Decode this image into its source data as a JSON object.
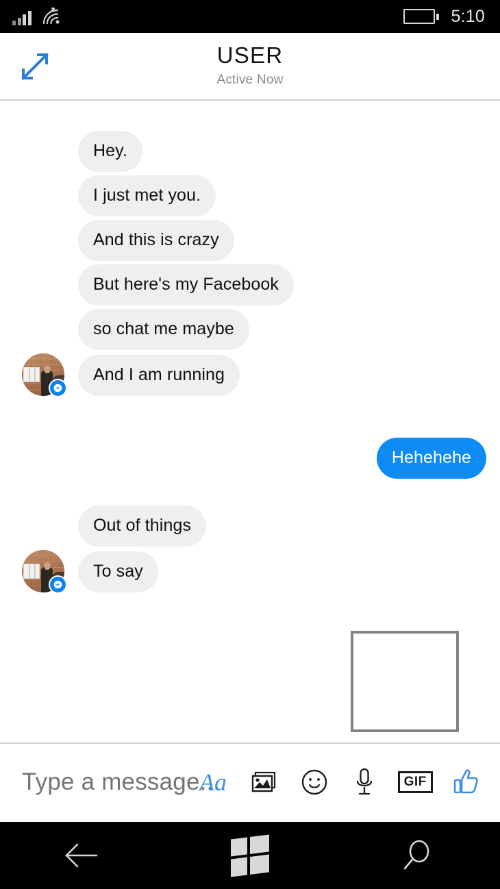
{
  "status_bar": {
    "signal_icon": "signal-bars-icon",
    "wifi_icon": "wifi-icon",
    "battery_icon": "battery-icon",
    "clock": "5:10"
  },
  "header": {
    "expand_icon": "expand-arrows-icon",
    "title": "USER",
    "subtitle": "Active Now"
  },
  "conversation": {
    "messages": [
      {
        "text": "Hey.",
        "side": "incoming"
      },
      {
        "text": "I just met you.",
        "side": "incoming"
      },
      {
        "text": "And this is crazy",
        "side": "incoming"
      },
      {
        "text": "But here's my Facebook",
        "side": "incoming"
      },
      {
        "text": "so chat me maybe",
        "side": "incoming"
      },
      {
        "text": "And I am running",
        "side": "incoming"
      },
      {
        "text": "Hehehehe",
        "side": "outgoing"
      },
      {
        "text": "Out of things",
        "side": "incoming"
      },
      {
        "text": "To say",
        "side": "incoming"
      }
    ],
    "avatar_badge_icon": "messenger-badge-icon",
    "image_placeholder": "image-attachment-placeholder"
  },
  "composer": {
    "placeholder": "Type a message...",
    "value": "",
    "actions": [
      {
        "name": "text-format-icon",
        "label": "Aa"
      },
      {
        "name": "photo-gallery-icon",
        "label": ""
      },
      {
        "name": "emoji-smiley-icon",
        "label": ""
      },
      {
        "name": "microphone-icon",
        "label": ""
      },
      {
        "name": "gif-icon",
        "label": "GIF"
      },
      {
        "name": "thumbs-up-icon",
        "label": ""
      }
    ],
    "gif_label": "GIF",
    "aa_label": "Aa"
  },
  "nav_bar": {
    "back_icon": "back-arrow-icon",
    "home_icon": "windows-home-icon",
    "search_icon": "search-icon"
  },
  "colors": {
    "accent_blue": "#0f8bf5",
    "bubble_gray": "#efefef",
    "status_black": "#000000",
    "placeholder_gray": "#b4b4b4"
  }
}
